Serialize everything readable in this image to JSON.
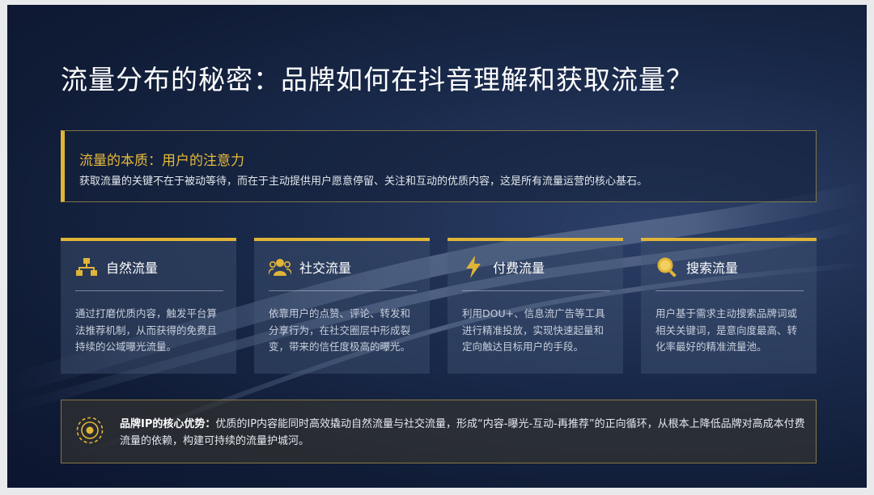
{
  "slide": {
    "title": "流量分布的秘密：品牌如何在抖音理解和获取流量？",
    "banner": {
      "heading": "流量的本质：用户的注意力",
      "text": "获取流量的关键不在于被动等待，而在于主动提供用户愿意停留、关注和互动的优质内容，这是所有流量运营的核心基石。"
    },
    "cards": [
      {
        "icon": "hierarchy-icon",
        "title": "自然流量",
        "text": "通过打磨优质内容，触发平台算法推荐机制，从而获得的免费且持续的公域曝光流量。"
      },
      {
        "icon": "users-icon",
        "title": "社交流量",
        "text": "依靠用户的点赞、评论、转发和分享行为，在社交圈层中形成裂变，带来的信任度极高的曝光。"
      },
      {
        "icon": "lightning-icon",
        "title": "付费流量",
        "text": "利用DOU+、信息流广告等工具进行精准投放，实现快速起量和定向触达目标用户的手段。"
      },
      {
        "icon": "search-icon",
        "title": "搜索流量",
        "text": "用户基于需求主动搜索品牌词或相关关键词，是意向度最高、转化率最好的精准流量池。"
      }
    ],
    "footer": {
      "icon": "target-icon",
      "strong": "品牌IP的核心优势：",
      "text": "优质的IP内容能同时高效撬动自然流量与社交流量，形成“内容-曝光-互动-再推荐”的正向循环，从根本上降低品牌对高成本付费流量的依赖，构建可持续的流量护城河。"
    },
    "colors": {
      "accent": "#e0b437",
      "background": "#1a2a4b",
      "text": "#ffffff"
    }
  }
}
